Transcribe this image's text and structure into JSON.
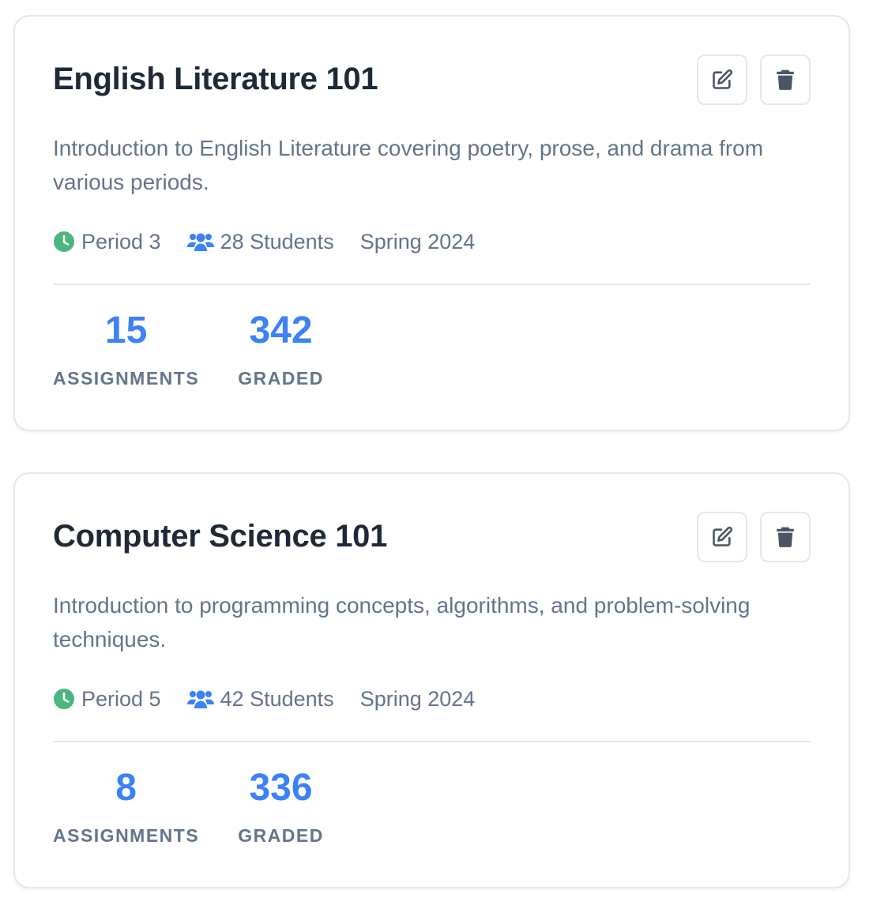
{
  "courses": [
    {
      "title": "English Literature 101",
      "description": "Introduction to English Literature covering poetry, prose, and drama from various periods.",
      "period": "Period 3",
      "students": "28 Students",
      "term": "Spring 2024",
      "assignments_value": "15",
      "assignments_label": "ASSIGNMENTS",
      "graded_value": "342",
      "graded_label": "GRADED",
      "edit_icon": "edit-icon",
      "delete_icon": "trash-icon"
    },
    {
      "title": "Computer Science 101",
      "description": "Introduction to programming concepts, algorithms, and problem-solving techniques.",
      "period": "Period 5",
      "students": "42 Students",
      "term": "Spring 2024",
      "assignments_value": "8",
      "assignments_label": "ASSIGNMENTS",
      "graded_value": "336",
      "graded_label": "GRADED",
      "edit_icon": "edit-icon",
      "delete_icon": "trash-icon"
    }
  ],
  "colors": {
    "accent": "#3b82f6",
    "clock": "#4bb67e",
    "title": "#1f2937",
    "muted": "#64748b",
    "border": "#e5e7eb"
  }
}
